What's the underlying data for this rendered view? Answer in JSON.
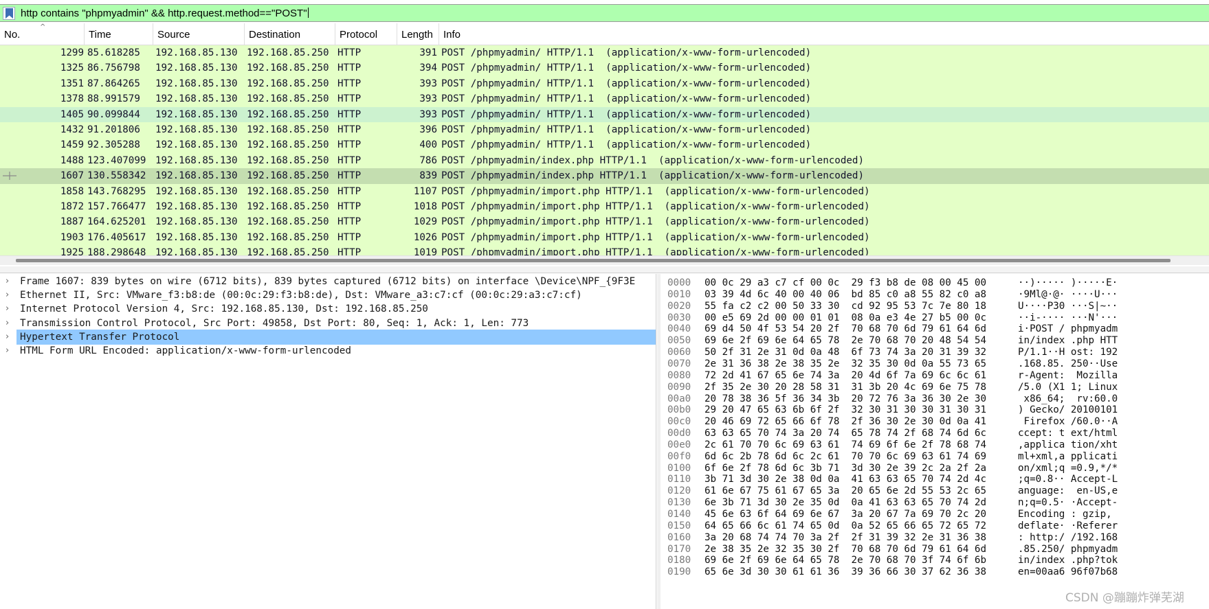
{
  "filter": {
    "text": "http contains \"phpmyadmin\" && http.request.method==\"POST\""
  },
  "columns": [
    "No.",
    "Time",
    "Source",
    "Destination",
    "Protocol",
    "Length",
    "Info"
  ],
  "packets": [
    {
      "no": "1299",
      "time": "85.618285",
      "src": "192.168.85.130",
      "dst": "192.168.85.250",
      "proto": "HTTP",
      "len": "391",
      "info": "POST /phpmyadmin/ HTTP/1.1  (application/x-www-form-urlencoded)"
    },
    {
      "no": "1325",
      "time": "86.756798",
      "src": "192.168.85.130",
      "dst": "192.168.85.250",
      "proto": "HTTP",
      "len": "394",
      "info": "POST /phpmyadmin/ HTTP/1.1  (application/x-www-form-urlencoded)"
    },
    {
      "no": "1351",
      "time": "87.864265",
      "src": "192.168.85.130",
      "dst": "192.168.85.250",
      "proto": "HTTP",
      "len": "393",
      "info": "POST /phpmyadmin/ HTTP/1.1  (application/x-www-form-urlencoded)"
    },
    {
      "no": "1378",
      "time": "88.991579",
      "src": "192.168.85.130",
      "dst": "192.168.85.250",
      "proto": "HTTP",
      "len": "393",
      "info": "POST /phpmyadmin/ HTTP/1.1  (application/x-www-form-urlencoded)"
    },
    {
      "no": "1405",
      "time": "90.099844",
      "src": "192.168.85.130",
      "dst": "192.168.85.250",
      "proto": "HTTP",
      "len": "393",
      "info": "POST /phpmyadmin/ HTTP/1.1  (application/x-www-form-urlencoded)"
    },
    {
      "no": "1432",
      "time": "91.201806",
      "src": "192.168.85.130",
      "dst": "192.168.85.250",
      "proto": "HTTP",
      "len": "396",
      "info": "POST /phpmyadmin/ HTTP/1.1  (application/x-www-form-urlencoded)"
    },
    {
      "no": "1459",
      "time": "92.305288",
      "src": "192.168.85.130",
      "dst": "192.168.85.250",
      "proto": "HTTP",
      "len": "400",
      "info": "POST /phpmyadmin/ HTTP/1.1  (application/x-www-form-urlencoded)"
    },
    {
      "no": "1488",
      "time": "123.407099",
      "src": "192.168.85.130",
      "dst": "192.168.85.250",
      "proto": "HTTP",
      "len": "786",
      "info": "POST /phpmyadmin/index.php HTTP/1.1  (application/x-www-form-urlencoded)"
    },
    {
      "no": "1607",
      "time": "130.558342",
      "src": "192.168.85.130",
      "dst": "192.168.85.250",
      "proto": "HTTP",
      "len": "839",
      "info": "POST /phpmyadmin/index.php HTTP/1.1  (application/x-www-form-urlencoded)"
    },
    {
      "no": "1858",
      "time": "143.768295",
      "src": "192.168.85.130",
      "dst": "192.168.85.250",
      "proto": "HTTP",
      "len": "1107",
      "info": "POST /phpmyadmin/import.php HTTP/1.1  (application/x-www-form-urlencoded)"
    },
    {
      "no": "1872",
      "time": "157.766477",
      "src": "192.168.85.130",
      "dst": "192.168.85.250",
      "proto": "HTTP",
      "len": "1018",
      "info": "POST /phpmyadmin/import.php HTTP/1.1  (application/x-www-form-urlencoded)"
    },
    {
      "no": "1887",
      "time": "164.625201",
      "src": "192.168.85.130",
      "dst": "192.168.85.250",
      "proto": "HTTP",
      "len": "1029",
      "info": "POST /phpmyadmin/import.php HTTP/1.1  (application/x-www-form-urlencoded)"
    },
    {
      "no": "1903",
      "time": "176.405617",
      "src": "192.168.85.130",
      "dst": "192.168.85.250",
      "proto": "HTTP",
      "len": "1026",
      "info": "POST /phpmyadmin/import.php HTTP/1.1  (application/x-www-form-urlencoded)"
    },
    {
      "no": "1925",
      "time": "188.298648",
      "src": "192.168.85.130",
      "dst": "192.168.85.250",
      "proto": "HTTP",
      "len": "1019",
      "info": "POST /phpmyadmin/import.php HTTP/1.1  (application/x-www-form-urlencoded)"
    }
  ],
  "details": [
    "Frame 1607: 839 bytes on wire (6712 bits), 839 bytes captured (6712 bits) on interface \\Device\\NPF_{9F3E",
    "Ethernet II, Src: VMware_f3:b8:de (00:0c:29:f3:b8:de), Dst: VMware_a3:c7:cf (00:0c:29:a3:c7:cf)",
    "Internet Protocol Version 4, Src: 192.168.85.130, Dst: 192.168.85.250",
    "Transmission Control Protocol, Src Port: 49858, Dst Port: 80, Seq: 1, Ack: 1, Len: 773",
    "Hypertext Transfer Protocol",
    "HTML Form URL Encoded: application/x-www-form-urlencoded"
  ],
  "bytes": [
    {
      "off": "0000",
      "hex": "00 0c 29 a3 c7 cf 00 0c  29 f3 b8 de 08 00 45 00",
      "ascii": "··)····· )·····E·"
    },
    {
      "off": "0010",
      "hex": "03 39 4d 6c 40 00 40 06  bd 85 c0 a8 55 82 c0 a8",
      "ascii": "·9Ml@·@· ····U···"
    },
    {
      "off": "0020",
      "hex": "55 fa c2 c2 00 50 33 30  cd 92 95 53 7c 7e 80 18",
      "ascii": "U····P30 ···S|~··"
    },
    {
      "off": "0030",
      "hex": "00 e5 69 2d 00 00 01 01  08 0a e3 4e 27 b5 00 0c",
      "ascii": "··i-···· ···N'···"
    },
    {
      "off": "0040",
      "hex": "69 d4 50 4f 53 54 20 2f  70 68 70 6d 79 61 64 6d",
      "ascii": "i·POST / phpmyadm"
    },
    {
      "off": "0050",
      "hex": "69 6e 2f 69 6e 64 65 78  2e 70 68 70 20 48 54 54",
      "ascii": "in/index .php HTT"
    },
    {
      "off": "0060",
      "hex": "50 2f 31 2e 31 0d 0a 48  6f 73 74 3a 20 31 39 32",
      "ascii": "P/1.1··H ost: 192"
    },
    {
      "off": "0070",
      "hex": "2e 31 36 38 2e 38 35 2e  32 35 30 0d 0a 55 73 65",
      "ascii": ".168.85. 250··Use"
    },
    {
      "off": "0080",
      "hex": "72 2d 41 67 65 6e 74 3a  20 4d 6f 7a 69 6c 6c 61",
      "ascii": "r-Agent:  Mozilla"
    },
    {
      "off": "0090",
      "hex": "2f 35 2e 30 20 28 58 31  31 3b 20 4c 69 6e 75 78",
      "ascii": "/5.0 (X1 1; Linux"
    },
    {
      "off": "00a0",
      "hex": "20 78 38 36 5f 36 34 3b  20 72 76 3a 36 30 2e 30",
      "ascii": " x86_64;  rv:60.0"
    },
    {
      "off": "00b0",
      "hex": "29 20 47 65 63 6b 6f 2f  32 30 31 30 30 31 30 31",
      "ascii": ") Gecko/ 20100101"
    },
    {
      "off": "00c0",
      "hex": "20 46 69 72 65 66 6f 78  2f 36 30 2e 30 0d 0a 41",
      "ascii": " Firefox /60.0··A"
    },
    {
      "off": "00d0",
      "hex": "63 63 65 70 74 3a 20 74  65 78 74 2f 68 74 6d 6c",
      "ascii": "ccept: t ext/html"
    },
    {
      "off": "00e0",
      "hex": "2c 61 70 70 6c 69 63 61  74 69 6f 6e 2f 78 68 74",
      "ascii": ",applica tion/xht"
    },
    {
      "off": "00f0",
      "hex": "6d 6c 2b 78 6d 6c 2c 61  70 70 6c 69 63 61 74 69",
      "ascii": "ml+xml,a pplicati"
    },
    {
      "off": "0100",
      "hex": "6f 6e 2f 78 6d 6c 3b 71  3d 30 2e 39 2c 2a 2f 2a",
      "ascii": "on/xml;q =0.9,*/*"
    },
    {
      "off": "0110",
      "hex": "3b 71 3d 30 2e 38 0d 0a  41 63 63 65 70 74 2d 4c",
      "ascii": ";q=0.8·· Accept-L"
    },
    {
      "off": "0120",
      "hex": "61 6e 67 75 61 67 65 3a  20 65 6e 2d 55 53 2c 65",
      "ascii": "anguage:  en-US,e"
    },
    {
      "off": "0130",
      "hex": "6e 3b 71 3d 30 2e 35 0d  0a 41 63 63 65 70 74 2d",
      "ascii": "n;q=0.5· ·Accept-"
    },
    {
      "off": "0140",
      "hex": "45 6e 63 6f 64 69 6e 67  3a 20 67 7a 69 70 2c 20",
      "ascii": "Encoding : gzip, "
    },
    {
      "off": "0150",
      "hex": "64 65 66 6c 61 74 65 0d  0a 52 65 66 65 72 65 72",
      "ascii": "deflate· ·Referer"
    },
    {
      "off": "0160",
      "hex": "3a 20 68 74 74 70 3a 2f  2f 31 39 32 2e 31 36 38",
      "ascii": ": http:/ /192.168"
    },
    {
      "off": "0170",
      "hex": "2e 38 35 2e 32 35 30 2f  70 68 70 6d 79 61 64 6d",
      "ascii": ".85.250/ phpmyadm"
    },
    {
      "off": "0180",
      "hex": "69 6e 2f 69 6e 64 65 78  2e 70 68 70 3f 74 6f 6b",
      "ascii": "in/index .php?tok"
    },
    {
      "off": "0190",
      "hex": "65 6e 3d 30 30 61 61 36  39 36 66 30 37 62 36 38",
      "ascii": "en=00aa6 96f07b68"
    }
  ],
  "watermark": "CSDN @蹦蹦炸弹芜湖",
  "colors": {
    "filter_valid": "#afffaf",
    "row_http": "#e4ffc7",
    "row_selected": "#c4deb0",
    "tree_selected": "#91c9ff"
  }
}
